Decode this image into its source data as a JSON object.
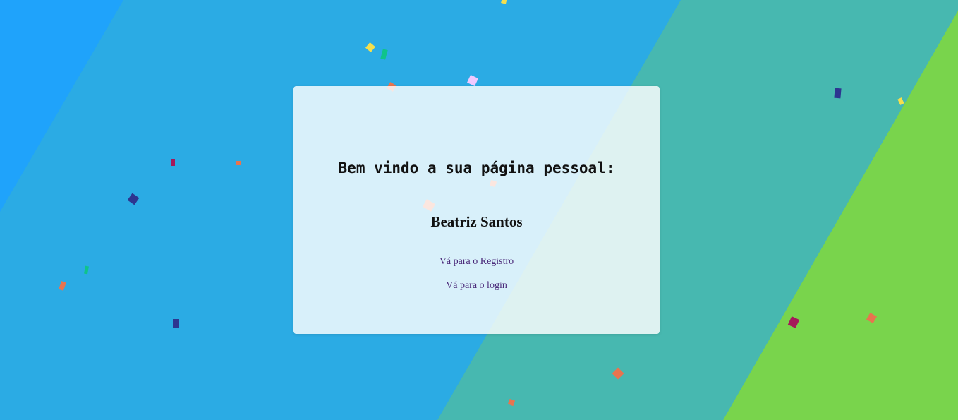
{
  "card": {
    "heading": "Bem vindo a sua página pessoal:",
    "user_name": "Beatriz Santos",
    "links": {
      "register": "Vá para o Registro",
      "login": "Vá para o login"
    }
  },
  "background": {
    "stripe_colors": [
      "#1fa3fb",
      "#2babe4",
      "#47b8b0",
      "#79d44c"
    ]
  },
  "confetti_colors": [
    "#f4df4d",
    "#0fc38a",
    "#e8744f",
    "#f0c9ff",
    "#a5195a",
    "#2d3590"
  ]
}
